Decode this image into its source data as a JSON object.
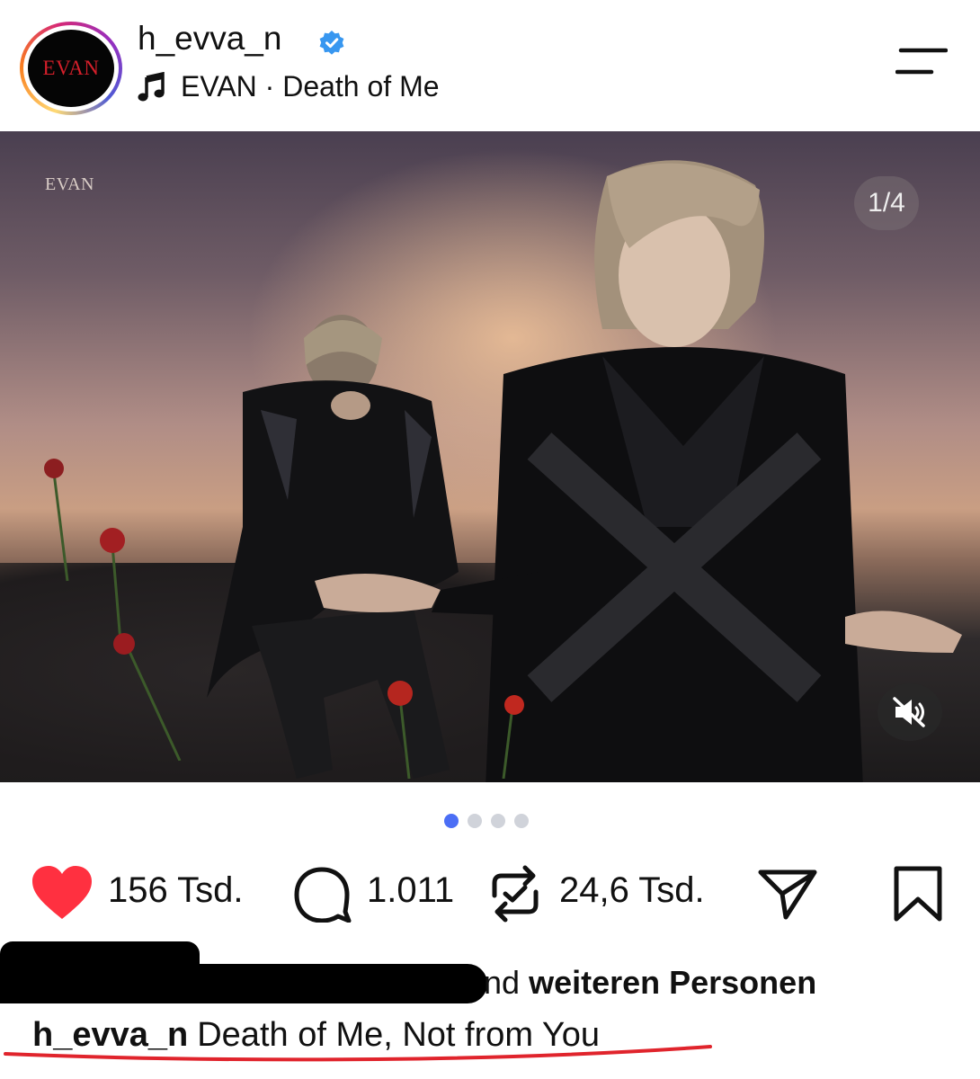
{
  "header": {
    "avatar_text": "EVAN",
    "username": "h_evva_n",
    "verified": true,
    "song": "EVAN · Death of Me",
    "icons": [
      "music-note-icon",
      "menu-icon",
      "verified-badge-icon"
    ]
  },
  "photo": {
    "watermark": "EVAN",
    "counter": "1/4",
    "icons": [
      "muted-speaker-icon"
    ]
  },
  "carousel": {
    "total": 4,
    "active": 1
  },
  "actions": {
    "likes": "156 Tsd.",
    "comments": "1.011",
    "reposts": "24,6 Tsd.",
    "icons": [
      "heart-icon",
      "comment-icon",
      "repost-icon",
      "share-icon",
      "bookmark-icon"
    ]
  },
  "likes_line": {
    "visible_fragment": "nd",
    "bold_text": "weiteren Personen"
  },
  "caption": {
    "username": "h_evva_n",
    "text": "Death of Me, Not from You"
  },
  "colors": {
    "like_red": "#ff3040",
    "verified_blue": "#3897f0",
    "active_dot": "#4b6ef5",
    "underline_red": "#e0242c"
  }
}
